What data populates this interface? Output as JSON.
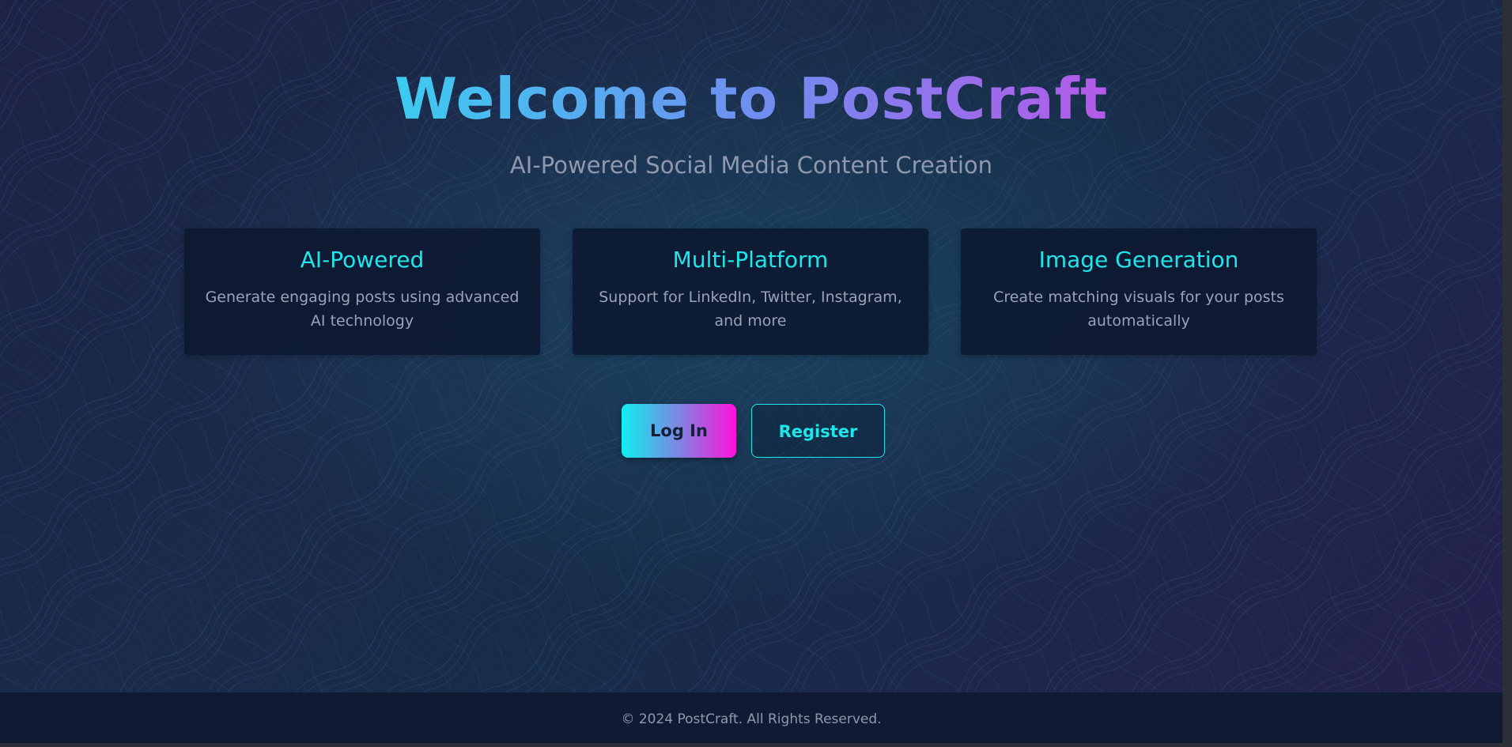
{
  "hero": {
    "title": "Welcome to PostCraft",
    "subtitle": "AI-Powered Social Media Content Creation"
  },
  "features": [
    {
      "title": "AI-Powered",
      "description": "Generate engaging posts using advanced AI technology"
    },
    {
      "title": "Multi-Platform",
      "description": "Support for LinkedIn, Twitter, Instagram, and more"
    },
    {
      "title": "Image Generation",
      "description": "Create matching visuals for your posts automatically"
    }
  ],
  "actions": {
    "login_label": "Log In",
    "register_label": "Register"
  },
  "footer": {
    "copyright": "© 2024 PostCraft. All Rights Reserved."
  },
  "colors": {
    "accent_cyan": "#1ee6ea",
    "accent_magenta": "#ff10dc",
    "title_gradient_start": "#3ccbf0",
    "title_gradient_end": "#b45ae8",
    "card_background": "#0d1932",
    "footer_background": "#101b33"
  }
}
